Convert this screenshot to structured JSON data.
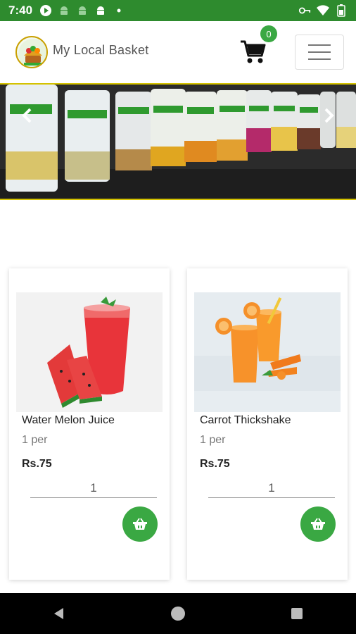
{
  "status_bar": {
    "time": "7:40",
    "left_icons": [
      "play-icon",
      "android-icon",
      "android-icon",
      "android-icon",
      "dot-icon"
    ],
    "right_icons": [
      "key-icon",
      "wifi-icon",
      "battery-icon"
    ]
  },
  "header": {
    "brand": "My Local Basket",
    "cart_count": "0",
    "logo_icon": "my-local-basket-logo",
    "cart_icon": "cart-icon",
    "menu_icon": "hamburger-menu-icon"
  },
  "carousel": {
    "prev_icon": "chevron-left-icon",
    "next_icon": "chevron-right-icon"
  },
  "products": [
    {
      "name": "Water Melon Juice",
      "unit": "1 per",
      "price": "Rs.75",
      "quantity": "1",
      "image": "watermelon-juice-image"
    },
    {
      "name": "Carrot Thickshake",
      "unit": "1 per",
      "price": "Rs.75",
      "quantity": "1",
      "image": "carrot-thickshake-image"
    }
  ],
  "nav_bar": {
    "icons": [
      "back-icon",
      "home-icon",
      "recents-icon"
    ]
  },
  "colors": {
    "status_bar": "#2e8b2e",
    "accent_green": "#3aa843",
    "carousel_border": "#d4c200"
  }
}
